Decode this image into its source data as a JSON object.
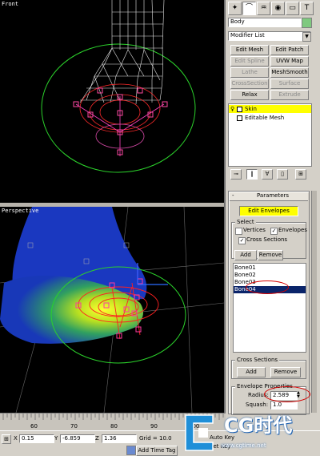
{
  "viewports": {
    "front": {
      "label": "Front"
    },
    "perspective": {
      "label": "Perspective"
    }
  },
  "panel": {
    "tabs": [
      "create-icon",
      "modify-icon",
      "hierarchy-icon",
      "motion-icon",
      "display-icon",
      "utilities-icon"
    ],
    "object_name": "Body",
    "object_color": "#7fc97f",
    "modifier_list": "Modifier List",
    "modifier_buttons": [
      {
        "label": "Edit Mesh",
        "enabled": true
      },
      {
        "label": "Edit Patch",
        "enabled": true
      },
      {
        "label": "Edit Spline",
        "enabled": false
      },
      {
        "label": "UVW Map",
        "enabled": true
      },
      {
        "label": "Lathe",
        "enabled": false
      },
      {
        "label": "MeshSmooth",
        "enabled": true
      },
      {
        "label": "CrossSection",
        "enabled": false
      },
      {
        "label": "Surface",
        "enabled": false
      },
      {
        "label": "Relax",
        "enabled": true
      },
      {
        "label": "Extrude",
        "enabled": false
      }
    ],
    "stack": [
      {
        "label": "Skin",
        "selected": true
      },
      {
        "label": "Editable Mesh",
        "selected": false
      }
    ],
    "parameters": {
      "rollout_title": "Parameters",
      "edit_envelopes": "Edit Envelopes",
      "select_group": "Select",
      "vertices": {
        "label": "Vertices",
        "checked": false
      },
      "envelopes": {
        "label": "Envelopes",
        "checked": true
      },
      "cross_sections": {
        "label": "Cross Sections",
        "checked": true
      },
      "add": "Add",
      "remove": "Remove",
      "bones": [
        "Bone01",
        "Bone02",
        "Bone03",
        "Bone04"
      ],
      "selected_bone": "Bone04",
      "cross_sections_group": "Cross Sections",
      "cs_add": "Add",
      "cs_remove": "Remove",
      "envelope_group": "Envelope Properties",
      "radius_label": "Radius:",
      "radius_value": "2.589",
      "squash_label": "Squash:",
      "squash_value": "1.0"
    }
  },
  "timeline": {
    "ticks": [
      "60",
      "70",
      "80",
      "90",
      "100"
    ]
  },
  "status": {
    "x_label": "X",
    "x_value": "0.15",
    "y_label": "Y",
    "y_value": "-6.859",
    "z_label": "Z",
    "z_value": "1.36",
    "grid": "Grid = 10.0",
    "add_time_tag": "Add Time Tag",
    "auto_key": "Auto Key",
    "set_key": "Set Key"
  },
  "watermark": {
    "text": "CG时代",
    "url": "www.cgtime.net"
  }
}
